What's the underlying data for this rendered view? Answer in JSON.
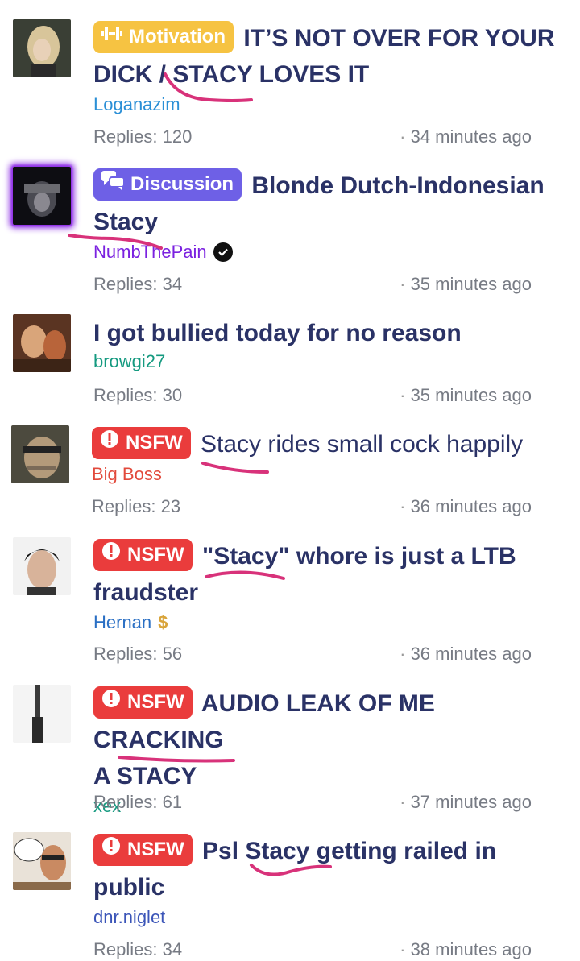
{
  "colors": {
    "title": "#2a3266",
    "meta": "#777b84",
    "badge_motivation": "#f6c342",
    "badge_discussion": "#6e60e6",
    "badge_nsfw": "#ea3c3c",
    "scribble": "#d8327a"
  },
  "threads": [
    {
      "badge": "Motivation",
      "badge_icon": "dumbbell-icon",
      "title_1": "IT’S NOT OVER FOR YOUR",
      "title_2": "DICK / STACY LOVES IT",
      "author": "Loganazim",
      "author_color": "#2b8fd6",
      "replies": "Replies: 120",
      "time": "34 minutes ago"
    },
    {
      "badge": "Discussion",
      "badge_icon": "chat-bubbles-icon",
      "title_1": "Blonde Dutch-Indonesian",
      "title_2": "Stacy",
      "author": "NumbThePain",
      "author_color": "#7b22e0",
      "author_verified": true,
      "replies": "Replies: 34",
      "time": "35 minutes ago"
    },
    {
      "badge": "",
      "title_1": "I got bullied today for no reason",
      "author": "browgi27",
      "author_color": "#159a80",
      "replies": "Replies: 30",
      "time": "35 minutes ago"
    },
    {
      "badge": "NSFW",
      "badge_icon": "alert-icon",
      "title_1": "Stacy rides small cock happily",
      "author": "Big Boss",
      "author_color": "#e24a3c",
      "replies": "Replies: 23",
      "time": "36 minutes ago"
    },
    {
      "badge": "NSFW",
      "badge_icon": "alert-icon",
      "title_1": "\"Stacy\" whore is just a LTB",
      "title_2": "fraudster",
      "author": "Hernan",
      "author_color": "#2a6fc4",
      "author_icon": "dollar-icon",
      "replies": "Replies: 56",
      "time": "36 minutes ago"
    },
    {
      "badge": "NSFW",
      "badge_icon": "alert-icon",
      "title_1": "AUDIO LEAK OF ME CRACKING",
      "title_2": "A STACY",
      "author": "xex",
      "author_color": "#159a80",
      "replies": "Replies: 61",
      "time": "37 minutes ago"
    },
    {
      "badge": "NSFW",
      "badge_icon": "alert-icon",
      "title_1": "Psl Stacy getting railed in",
      "title_2": "public",
      "author": "dnr.niglet",
      "author_color": "#3b55b8",
      "replies": "Replies: 34",
      "time": "38 minutes ago"
    }
  ]
}
